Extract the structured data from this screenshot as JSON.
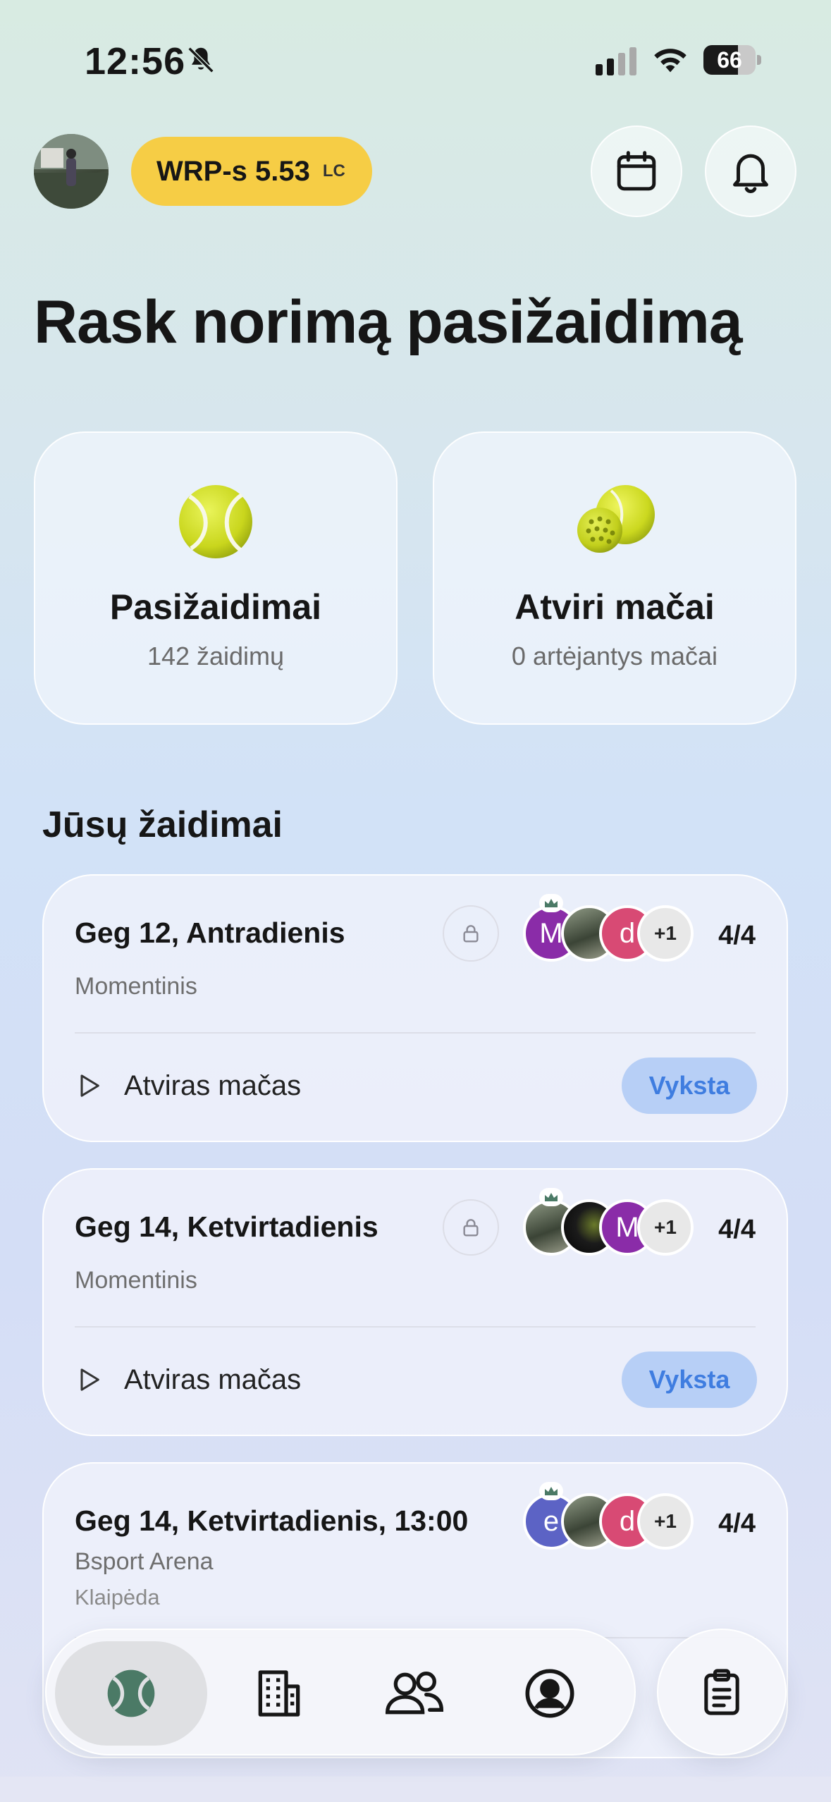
{
  "status_bar": {
    "time": "12:56",
    "battery": "66",
    "battery_level": 0.66,
    "icons": [
      "bell-slash-icon",
      "cellular-signal-icon",
      "wifi-icon",
      "battery-icon"
    ]
  },
  "header": {
    "wrp_label": "WRP-s 5.53",
    "wrp_suffix": "LC",
    "icons": [
      "calendar-icon",
      "bell-icon"
    ]
  },
  "page_title": "Rask norimą pasižaidimą",
  "categories": [
    {
      "title": "Pasižaidimai",
      "subtitle": "142 žaidimų",
      "icon": "tennis-ball-icon"
    },
    {
      "title": "Atviri mačai",
      "subtitle": "0 artėjantys mačai",
      "icon": "padel-balls-icon"
    }
  ],
  "section_title": "Jūsų žaidimai",
  "games": [
    {
      "date": "Geg 12, Antradienis",
      "type": "Momentinis",
      "players": [
        {
          "letter": "M"
        },
        {
          "letter": ""
        },
        {
          "letter": "d"
        }
      ],
      "extra_players": "+1",
      "count": "4/4",
      "label": "Atviras mačas",
      "status": "Vyksta"
    },
    {
      "date": "Geg 14, Ketvirtadienis",
      "type": "Momentinis",
      "players": [
        {
          "letter": ""
        },
        {
          "letter": ""
        },
        {
          "letter": "M"
        }
      ],
      "extra_players": "+1",
      "count": "4/4",
      "label": "Atviras mačas",
      "status": "Vyksta"
    },
    {
      "date": "Geg 14, Ketvirtadienis, 13:00",
      "venue": "Bsport Arena",
      "city": "Klaipėda",
      "players": [
        {
          "letter": "e"
        },
        {
          "letter": ""
        },
        {
          "letter": "d"
        }
      ],
      "extra_players": "+1",
      "count": "4/4"
    }
  ],
  "bottom_nav": {
    "items": [
      "tennis-ball-icon",
      "building-icon",
      "users-icon",
      "profile-icon"
    ],
    "active": 0,
    "fab_icon": "clipboard-icon"
  },
  "colors": {
    "accent_yellow": "#f6cd45",
    "status_blue_bg": "#b7cff6",
    "status_blue_text": "#3f7de0",
    "nav_green": "#4b7a66"
  }
}
